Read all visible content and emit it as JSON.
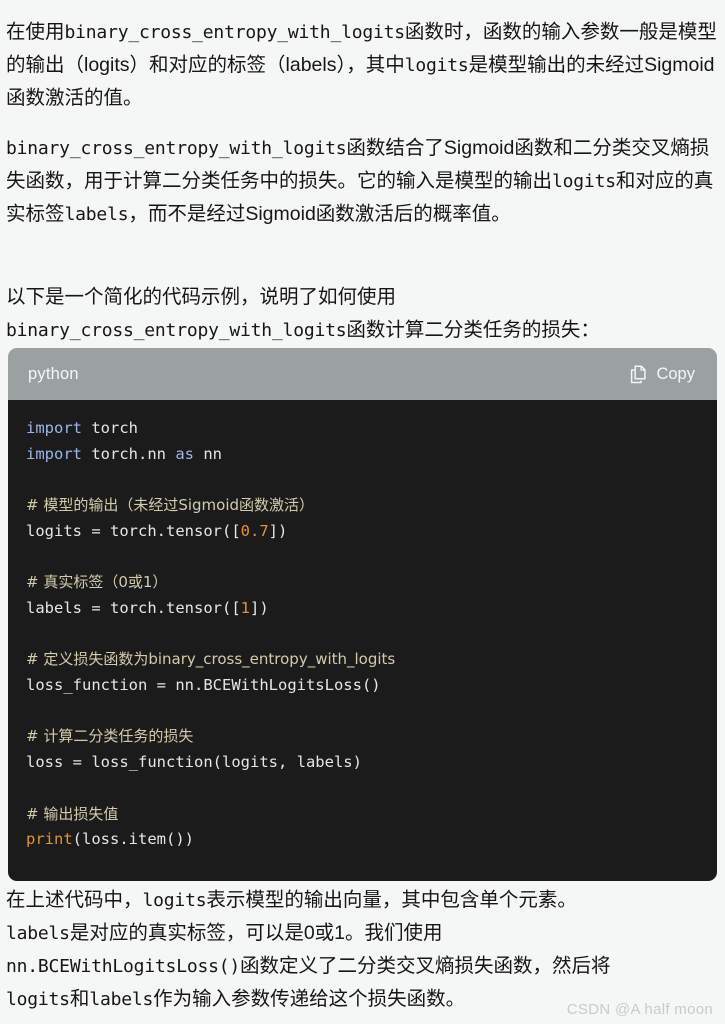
{
  "paragraphs": {
    "p1_a": "在使用",
    "p1_code": "binary_cross_entropy_with_logits",
    "p1_b": "函数时，函数的输入参数一般是模型的输出（logits）和对应的标签（labels），其中",
    "p1_code2": "logits",
    "p1_c": "是模型输出的未经过Sigmoid函数激活的值。",
    "p2_code": "binary_cross_entropy_with_logits",
    "p2_a": "函数结合了Sigmoid函数和二分类交叉熵损失函数，用于计算二分类任务中的损失。它的输入是模型的输出",
    "p2_code2": "logits",
    "p2_b": "和对应的真实标签",
    "p2_code3": "labels",
    "p2_c": "，而不是经过Sigmoid函数激活后的概率值。",
    "p3_a": "以下是一个简化的代码示例，说明了如何使用",
    "p3_code": "binary_cross_entropy_with_logits",
    "p3_b": "函数计算二分类任务的损失：",
    "p4_a": "在上述代码中，",
    "p4_code1": "logits",
    "p4_b": "表示模型的输出向量，其中包含单个元素。",
    "p4_code2": "labels",
    "p4_c": "是对应的真实标签，可以是0或1。我们使用",
    "p4_code3": "nn.BCEWithLogitsLoss()",
    "p4_d": "函数定义了二分类交叉熵损失函数，然后将",
    "p4_code4": "logits",
    "p4_e": "和",
    "p4_code5": "labels",
    "p4_f": "作为输入参数传递给这个损失函数。"
  },
  "code_block": {
    "language": "python",
    "copy_label": "Copy",
    "copy_icon": "copy-icon",
    "header_bg": "#9ba1a1",
    "body_bg": "#1b1b1b",
    "lines": [
      {
        "tokens": [
          {
            "t": "import",
            "c": "kw"
          },
          {
            "t": " torch",
            "c": "plain"
          }
        ]
      },
      {
        "tokens": [
          {
            "t": "import",
            "c": "kw"
          },
          {
            "t": " torch.nn ",
            "c": "plain"
          },
          {
            "t": "as",
            "c": "kw"
          },
          {
            "t": " nn",
            "c": "plain"
          }
        ]
      },
      {
        "tokens": []
      },
      {
        "tokens": [
          {
            "t": "# 模型的输出（未经过Sigmoid函数激活）",
            "c": "comment"
          }
        ]
      },
      {
        "tokens": [
          {
            "t": "logits ",
            "c": "plain"
          },
          {
            "t": "=",
            "c": "plain"
          },
          {
            "t": " torch.tensor([",
            "c": "plain"
          },
          {
            "t": "0.7",
            "c": "num"
          },
          {
            "t": "])",
            "c": "plain"
          }
        ]
      },
      {
        "tokens": []
      },
      {
        "tokens": [
          {
            "t": "# 真实标签（0或1）",
            "c": "comment"
          }
        ]
      },
      {
        "tokens": [
          {
            "t": "labels ",
            "c": "plain"
          },
          {
            "t": "=",
            "c": "plain"
          },
          {
            "t": " torch.tensor([",
            "c": "plain"
          },
          {
            "t": "1",
            "c": "num"
          },
          {
            "t": "])",
            "c": "plain"
          }
        ]
      },
      {
        "tokens": []
      },
      {
        "tokens": [
          {
            "t": "# 定义损失函数为binary_cross_entropy_with_logits",
            "c": "comment"
          }
        ]
      },
      {
        "tokens": [
          {
            "t": "loss_function ",
            "c": "plain"
          },
          {
            "t": "=",
            "c": "plain"
          },
          {
            "t": " nn.BCEWithLogitsLoss()",
            "c": "plain"
          }
        ]
      },
      {
        "tokens": []
      },
      {
        "tokens": [
          {
            "t": "# 计算二分类任务的损失",
            "c": "comment"
          }
        ]
      },
      {
        "tokens": [
          {
            "t": "loss ",
            "c": "plain"
          },
          {
            "t": "=",
            "c": "plain"
          },
          {
            "t": " loss_function(logits, labels)",
            "c": "plain"
          }
        ]
      },
      {
        "tokens": []
      },
      {
        "tokens": [
          {
            "t": "# 输出损失值",
            "c": "comment"
          }
        ]
      },
      {
        "tokens": [
          {
            "t": "print",
            "c": "builtin"
          },
          {
            "t": "(loss.item())",
            "c": "plain"
          }
        ]
      }
    ]
  },
  "watermark": {
    "text": "CSDN @A half moon"
  }
}
